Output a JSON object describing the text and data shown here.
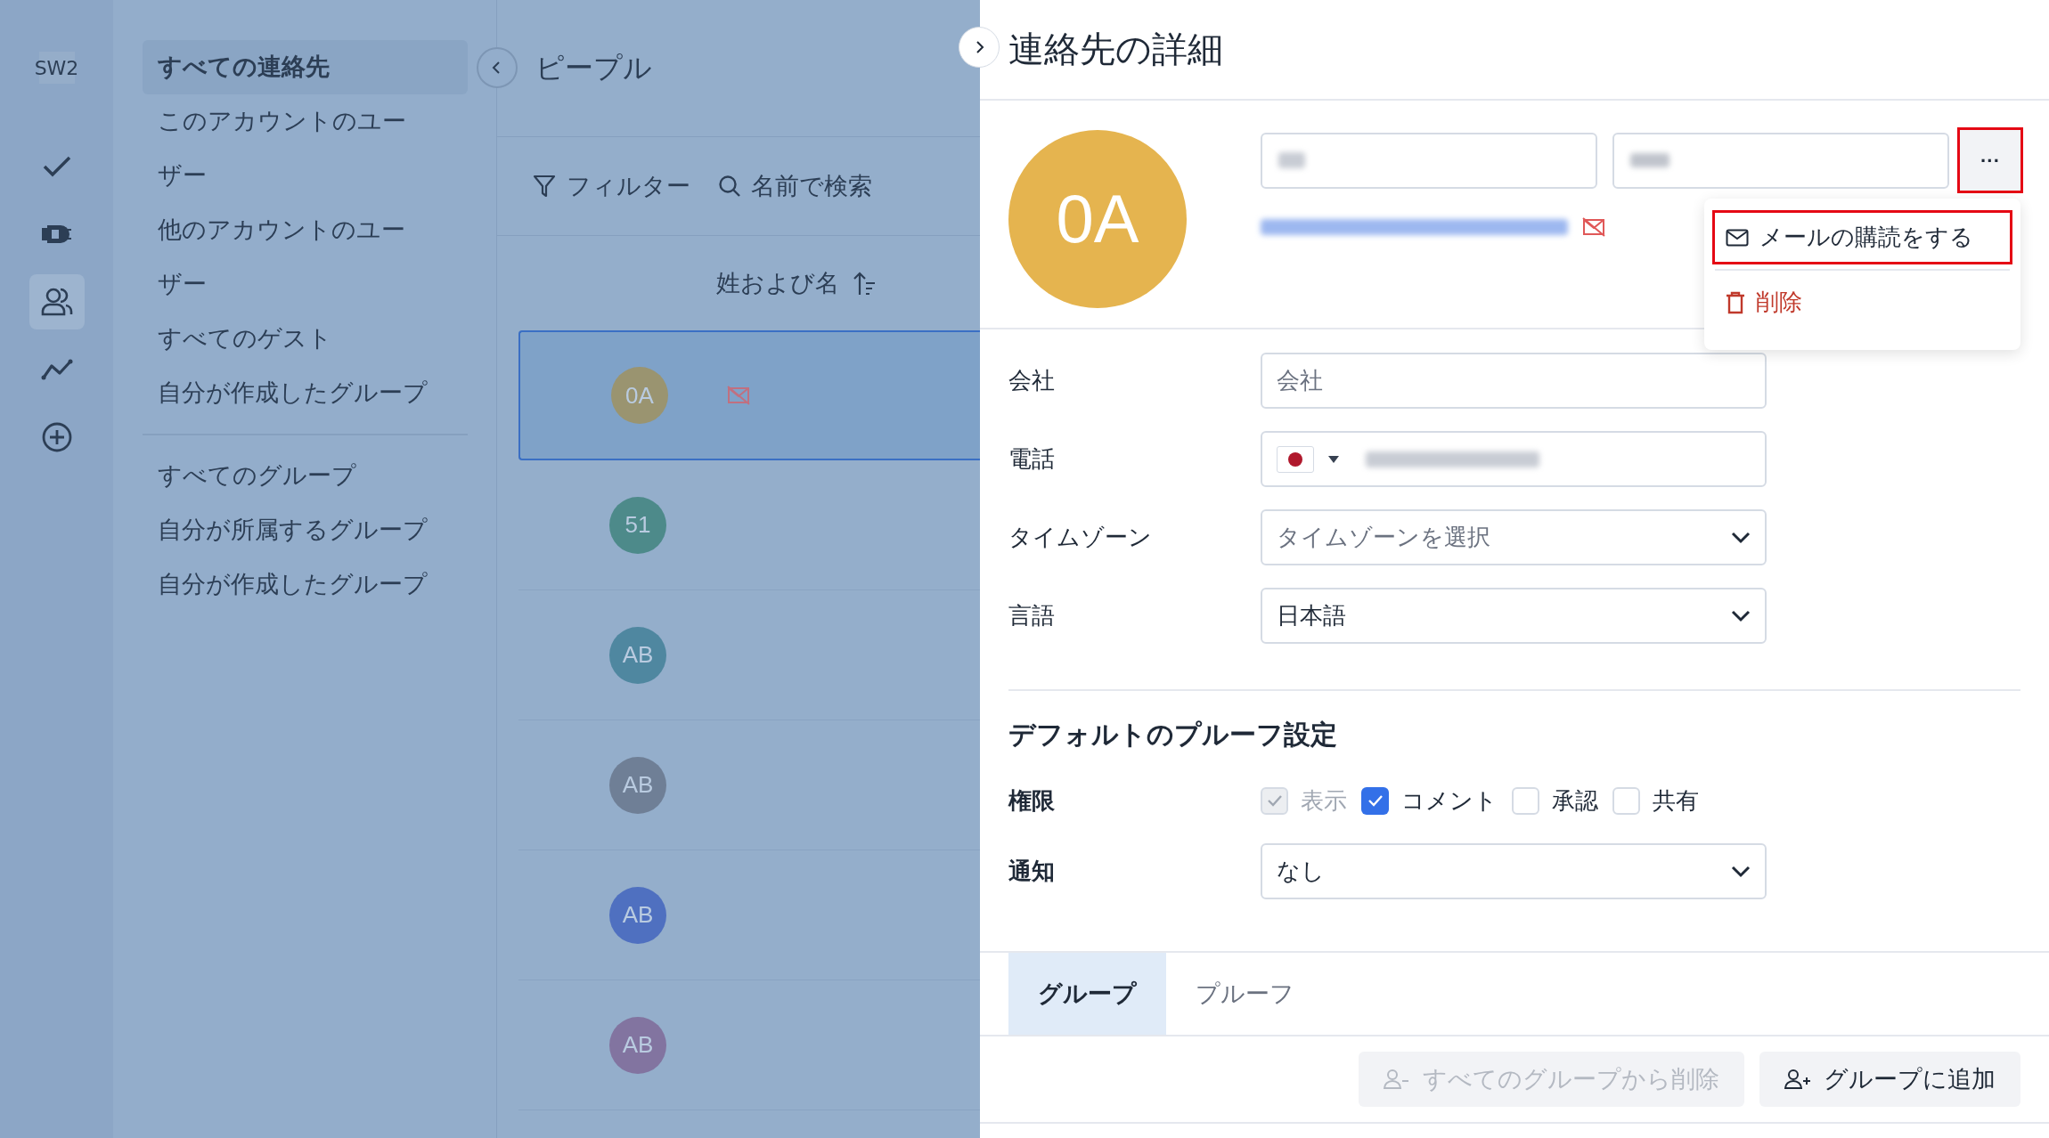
{
  "rail": {
    "logo": "SW2",
    "items": [
      {
        "kind": "check",
        "selected": false
      },
      {
        "kind": "plug",
        "selected": false
      },
      {
        "kind": "people",
        "selected": true
      },
      {
        "kind": "trend",
        "selected": false
      },
      {
        "kind": "add",
        "selected": false
      }
    ]
  },
  "sidebar": {
    "sections": [
      {
        "items": [
          {
            "label": "すべての連絡先",
            "selected": true
          },
          {
            "label": "このアカウントのユーザー",
            "selected": false
          },
          {
            "label": "他のアカウントのユーザー",
            "selected": false
          },
          {
            "label": "すべてのゲスト",
            "selected": false
          },
          {
            "label": "自分が作成したグループ",
            "selected": false
          }
        ]
      },
      {
        "items": [
          {
            "label": "すべてのグループ",
            "selected": false
          },
          {
            "label": "自分が所属するグループ",
            "selected": false
          },
          {
            "label": "自分が作成したグループ",
            "selected": false
          }
        ]
      }
    ]
  },
  "people": {
    "title": "ピープル",
    "filter": "フィルター",
    "search": {
      "placeholder": "名前で検索"
    },
    "column": "姓および名",
    "rows": [
      {
        "initials": "0A",
        "color": "#9a9470",
        "selected": true,
        "mail_off": true
      },
      {
        "initials": "51",
        "color": "#4d8a8a",
        "selected": false,
        "mail_off": false
      },
      {
        "initials": "AB",
        "color": "#4f87a0",
        "selected": false,
        "mail_off": false
      },
      {
        "initials": "AB",
        "color": "#6f7f96",
        "selected": false,
        "mail_off": false
      },
      {
        "initials": "AB",
        "color": "#4f70c0",
        "selected": false,
        "mail_off": false
      },
      {
        "initials": "AB",
        "color": "#8274a0",
        "selected": false,
        "mail_off": false
      }
    ]
  },
  "detail": {
    "title": "連絡先の詳細",
    "avatar": {
      "initials": "0A",
      "color": "#e5b44f"
    },
    "more": {
      "label": "···",
      "outlined": true
    },
    "menu": [
      {
        "kind": "mail",
        "label": "メールの購読をする",
        "outlined": true
      },
      {
        "kind": "delete",
        "label": "削除",
        "outlined": false
      }
    ],
    "fields": [
      {
        "kind": "text",
        "label": "会社",
        "placeholder": "会社"
      },
      {
        "kind": "phone",
        "label": "電話"
      },
      {
        "kind": "select",
        "label": "タイムゾーン",
        "placeholder": "タイムゾーンを選択"
      },
      {
        "kind": "select",
        "label": "言語",
        "value": "日本語"
      }
    ],
    "proof": {
      "heading": "デフォルトのプルーフ設定",
      "permissions_label": "権限",
      "permissions": [
        {
          "label": "表示",
          "checked": true,
          "disabled": true
        },
        {
          "label": "コメント",
          "checked": true,
          "disabled": false
        },
        {
          "label": "承認",
          "checked": false,
          "disabled": false
        },
        {
          "label": "共有",
          "checked": false,
          "disabled": false
        }
      ],
      "notify_label": "通知",
      "notify_value": "なし"
    },
    "tabs": [
      {
        "label": "グループ",
        "selected": true
      },
      {
        "label": "プルーフ",
        "selected": false
      }
    ],
    "buttons": [
      {
        "kind": "remove",
        "label": "すべてのグループから削除",
        "disabled": true
      },
      {
        "kind": "add",
        "label": "グループに追加",
        "disabled": false
      }
    ]
  }
}
